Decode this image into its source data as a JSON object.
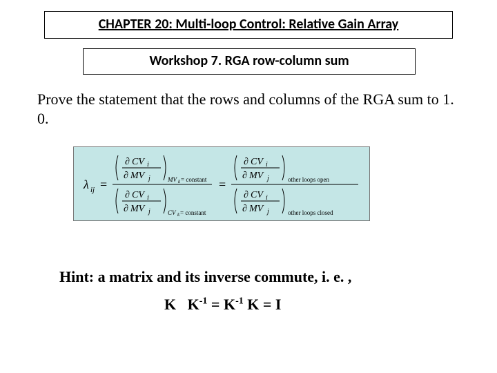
{
  "title": {
    "prefix": "CHAPTER 20:",
    "rest": " Multi-loop Control: Relative Gain Array"
  },
  "subtitle": "Workshop 7. RGA row-column sum",
  "prompt": "Prove the statement that the rows and columns of the RGA sum to 1. 0.",
  "hint": "Hint: a matrix and its inverse commute, i. e. ,",
  "formula": {
    "k": "K",
    "km1": "K",
    "exp1": "-1",
    "eq1": " = ",
    "km2": "K",
    "exp2": "-1",
    "k2": " K",
    "eq2": " = I"
  },
  "eqn": {
    "lambda": "λ",
    "ij": "ij",
    "eq": "=",
    "partial": "∂",
    "cv": "CV",
    "mv": "MV",
    "i": "i",
    "j": "j",
    "sub_mv_const": "MV",
    "sub_mv_k": "k",
    "sub_mv_eq": " = constant",
    "sub_cv_const": "CV",
    "sub_cv_k": "k",
    "sub_cv_eq": " = constant",
    "sub_open": "other loops open",
    "sub_closed": "other loops closed"
  }
}
